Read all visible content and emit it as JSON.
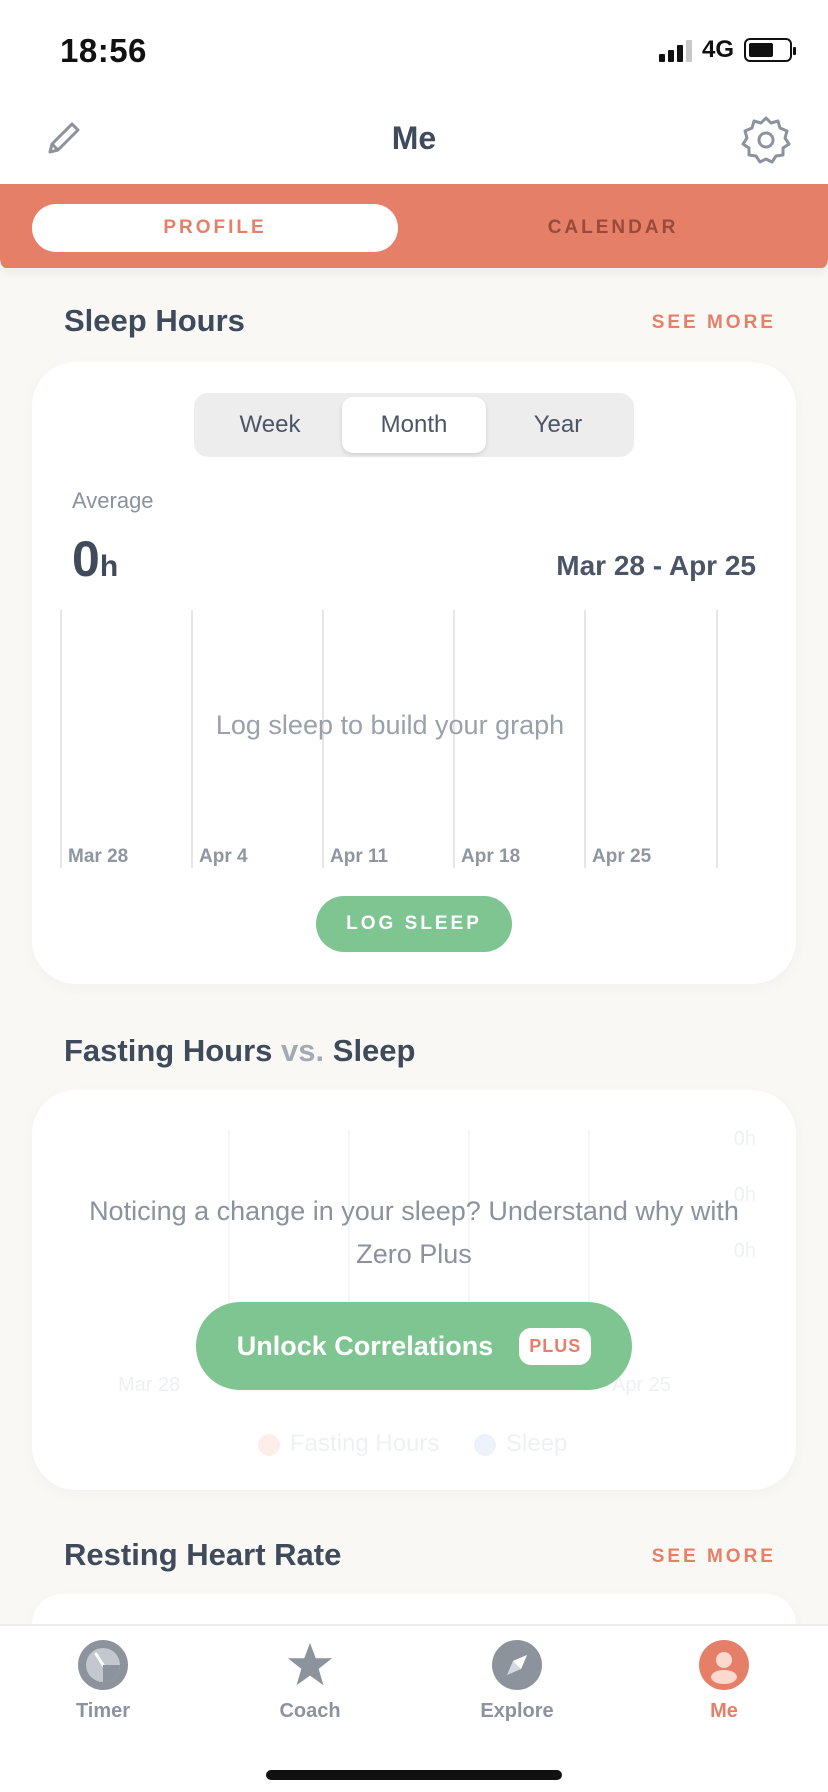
{
  "status_bar": {
    "time": "18:56",
    "network": "4G",
    "battery_level": 0.62
  },
  "header": {
    "title": "Me",
    "edit_icon": "pencil-icon",
    "settings_icon": "gear-icon"
  },
  "tabs": [
    {
      "label": "PROFILE",
      "active": true
    },
    {
      "label": "CALENDAR",
      "active": false
    }
  ],
  "sleep_section": {
    "title": "Sleep Hours",
    "see_more": "SEE MORE",
    "range_options": [
      "Week",
      "Month",
      "Year"
    ],
    "selected_range": "Month",
    "average_label": "Average",
    "average_value": "0",
    "average_unit": "h",
    "date_range": "Mar 28 - Apr 25",
    "graph_labels": [
      "Mar 28",
      "Apr 4",
      "Apr 11",
      "Apr 18",
      "Apr 25"
    ],
    "empty_message": "Log sleep to build your graph",
    "log_button": "LOG SLEEP"
  },
  "fasting_section": {
    "title_part1": "Fasting Hours",
    "title_vs": "vs.",
    "title_part2": "Sleep",
    "upsell_text": "Noticing a change in your sleep? Understand why with Zero Plus",
    "unlock_button": "Unlock Correlations",
    "plus_badge": "PLUS",
    "ghost_y_labels": [
      "0h",
      "0h",
      "0h"
    ],
    "ghost_x_labels": [
      "Mar 28",
      "Apr 25"
    ],
    "ghost_legend": [
      "Fasting Hours",
      "Sleep"
    ]
  },
  "heart_section": {
    "title": "Resting Heart Rate",
    "see_more": "SEE MORE"
  },
  "bottom_nav": [
    {
      "label": "Timer",
      "icon": "timer-icon",
      "active": false
    },
    {
      "label": "Coach",
      "icon": "star-icon",
      "active": false
    },
    {
      "label": "Explore",
      "icon": "compass-icon",
      "active": false
    },
    {
      "label": "Me",
      "icon": "profile-icon",
      "active": true
    }
  ],
  "colors": {
    "accent": "#e57f68",
    "green": "#7ec592",
    "text": "#3f4a5a",
    "muted": "#8c939d"
  }
}
